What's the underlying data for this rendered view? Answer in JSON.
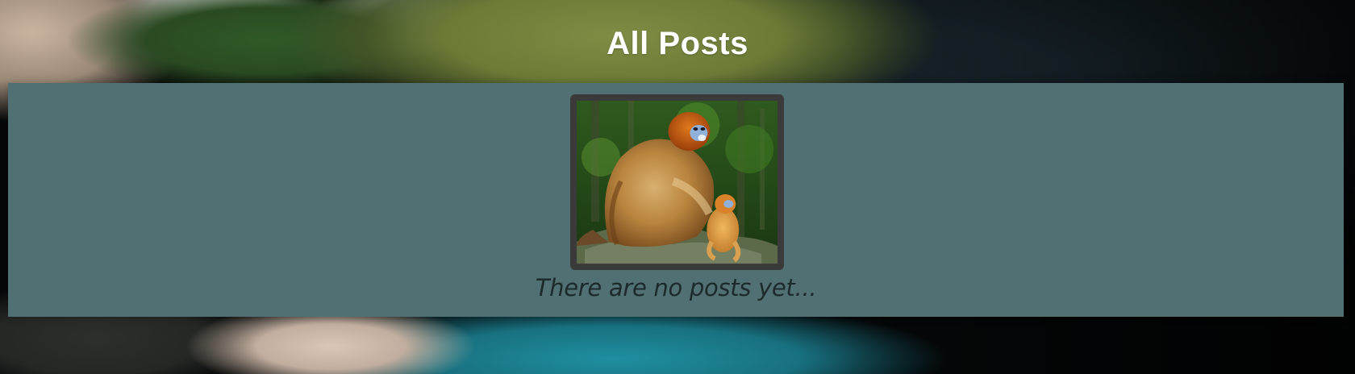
{
  "page": {
    "title": "All Posts"
  },
  "posts_panel": {
    "empty_message": "There are no posts yet...",
    "placeholder_image": {
      "subject": "golden snub-nosed monkey with baby on a rock in a forest",
      "frame_color": "#3a3a3a"
    },
    "panel_color": "#507073"
  },
  "background": {
    "subject": "aerial view of green hill, sandy beach and turquoise sea"
  },
  "colors": {
    "title_text": "#ffffff",
    "message_text": "#1c2a2c"
  }
}
